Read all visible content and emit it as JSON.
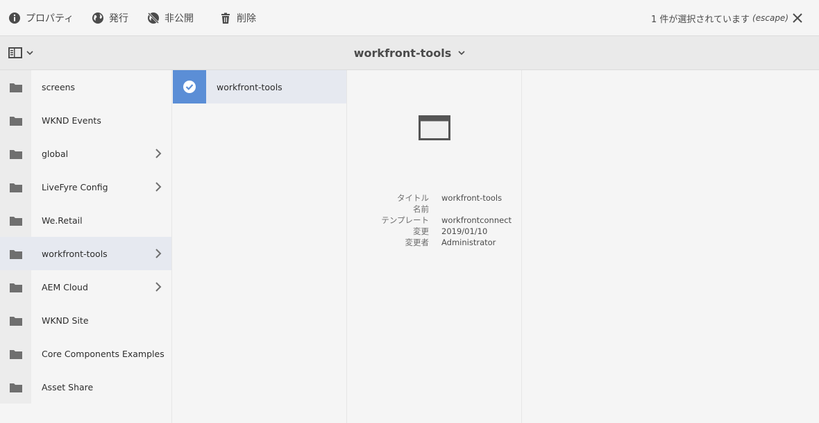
{
  "toolbar": {
    "properties_label": "プロパティ",
    "publish_label": "発行",
    "unpublish_label": "非公開",
    "delete_label": "削除",
    "selection_text": "1 件が選択されています",
    "escape_hint": "(escape)"
  },
  "header": {
    "title": "workfront-tools"
  },
  "column1": {
    "items": [
      {
        "label": "screens"
      },
      {
        "label": "WKND Events"
      },
      {
        "label": "global"
      },
      {
        "label": "LiveFyre Config"
      },
      {
        "label": "We.Retail"
      },
      {
        "label": "workfront-tools"
      },
      {
        "label": "AEM Cloud"
      },
      {
        "label": "WKND Site"
      },
      {
        "label": "Core Components Examples"
      },
      {
        "label": "Asset Share"
      }
    ]
  },
  "column2": {
    "selected_label": "workfront-tools"
  },
  "details": {
    "title_key": "タイトル",
    "title_value": "workfront-tools",
    "name_key": "名前",
    "name_value": "",
    "template_key": "テンプレート",
    "template_value": "workfrontconnect",
    "modified_key": "変更",
    "modified_value": "2019/01/10",
    "modified_by_key": "変更者",
    "modified_by_value": "Administrator"
  },
  "colors": {
    "selected_row": "#e6e9f0",
    "check_bg": "#5b8ed6"
  }
}
